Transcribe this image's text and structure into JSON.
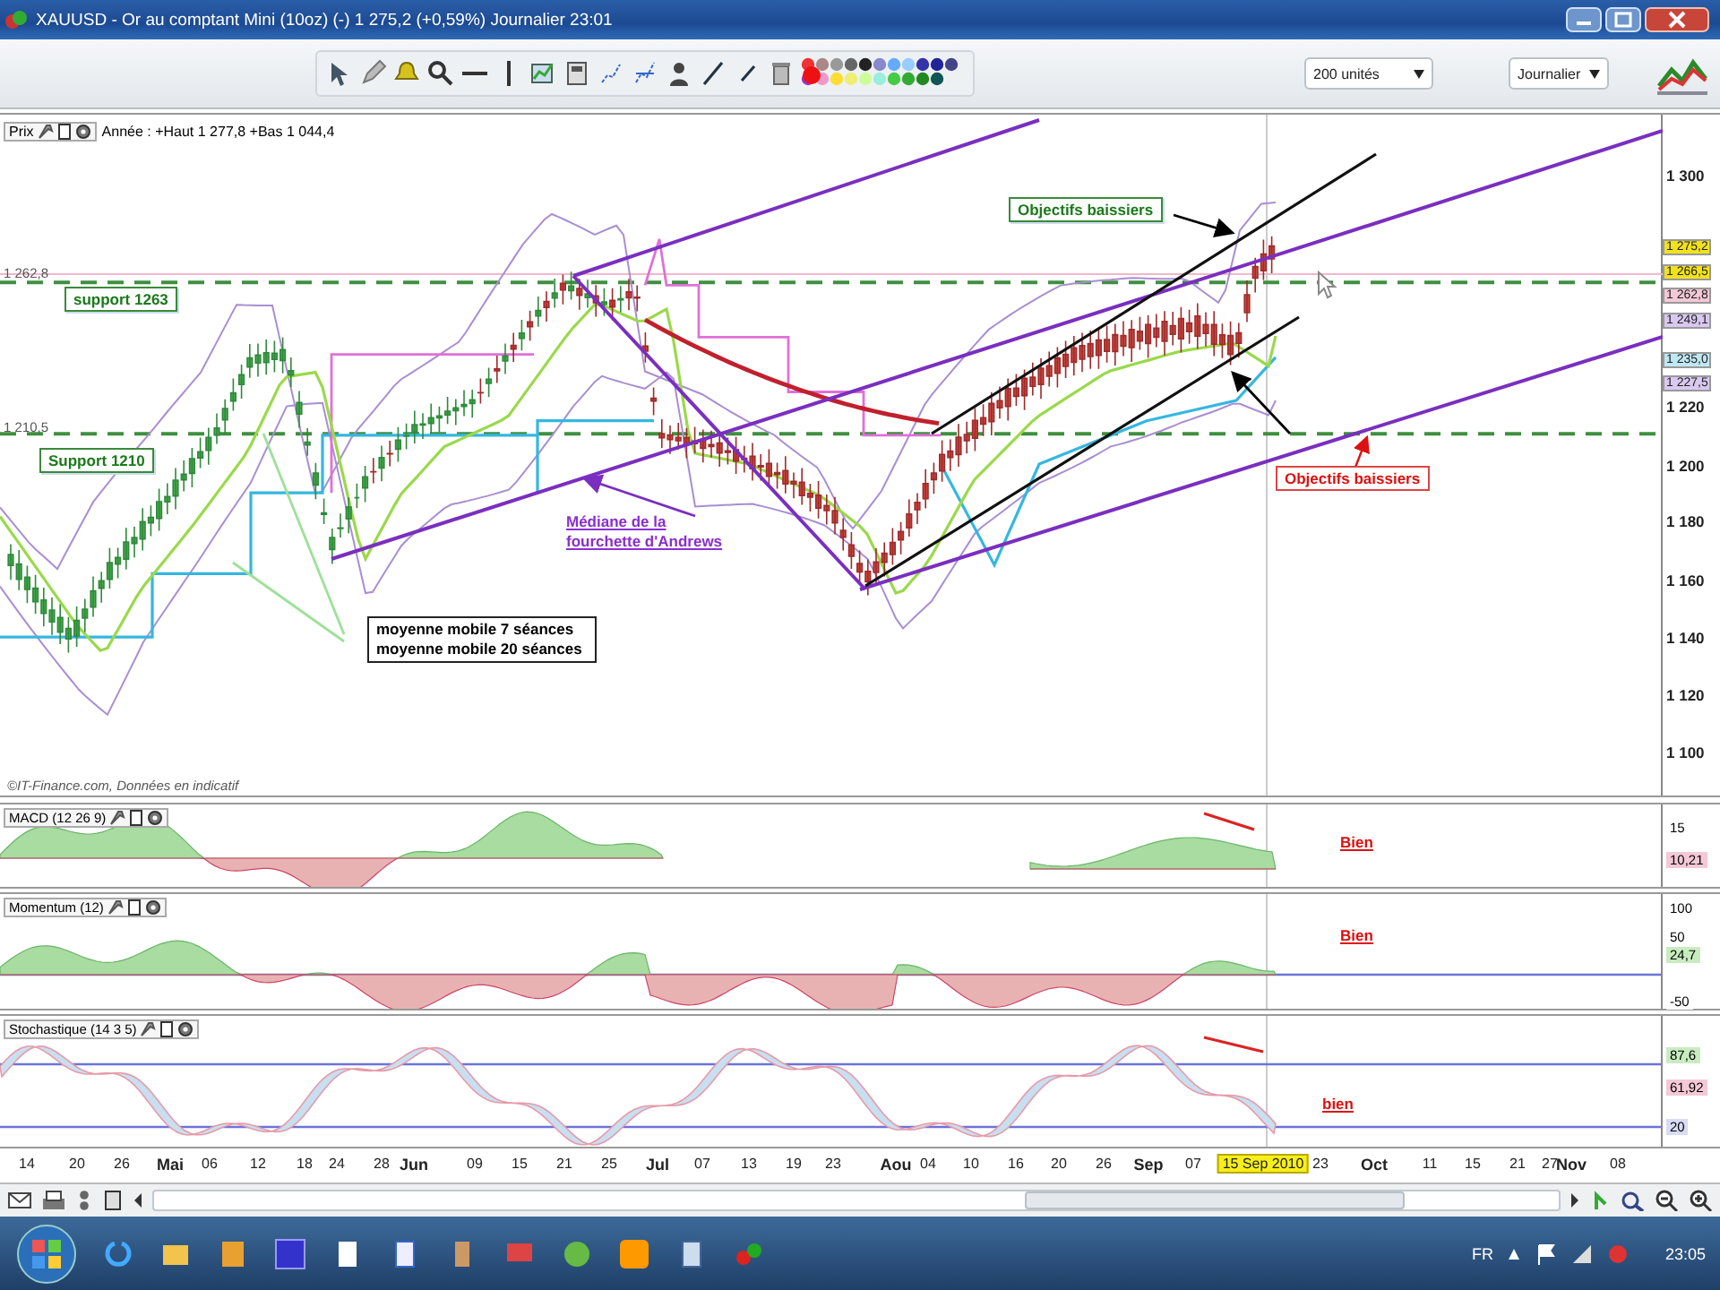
{
  "window": {
    "title": "XAUUSD - Or au comptant Mini (10oz) (-)   1 275,2 (+0,59%)   Journalier  23:01"
  },
  "toolbar": {
    "dropdowns": [
      {
        "value": "200 unités"
      },
      {
        "value": "Journalier"
      }
    ]
  },
  "main_chart": {
    "label": "Prix",
    "range_text": "Année : +Haut 1 277,8 +Bas 1 044,4",
    "level_labels": [
      "1 262,8",
      "1 210,5"
    ],
    "price_axis": [
      "1 300",
      "1 220",
      "1 200",
      "1 180",
      "1 160",
      "1 140",
      "1 120",
      "1 100"
    ],
    "price_tags": [
      {
        "text": "1 275,2",
        "color": "#f2e21c"
      },
      {
        "text": "1 266,5",
        "color": "#f2e21c"
      },
      {
        "text": "1 262,8",
        "color": "#f4c8d6"
      },
      {
        "text": "1 249,1",
        "color": "#d9c8f0"
      },
      {
        "text": "1 235,0",
        "color": "#bfe8f4"
      },
      {
        "text": "1 227,5",
        "color": "#d9c8f0"
      }
    ],
    "annotations": [
      {
        "text": "support 1263",
        "kind": "green_box"
      },
      {
        "text": "Support 1210",
        "kind": "green_box"
      },
      {
        "text": "Objectifs baissiers",
        "kind": "green_box"
      },
      {
        "text": "Objectifs baissiers",
        "kind": "red_box"
      },
      {
        "text": "Médiane de la fourchette d'Andrews",
        "kind": "link"
      },
      {
        "text": "moyenne mobile 7 séances moyenne mobile 20 séances",
        "kind": "black_box"
      }
    ],
    "copyright": "©IT-Finance.com, Données en indicatif"
  },
  "indicators": [
    {
      "kind": "macd",
      "label": "MACD (12 26 9)",
      "note": "Bien",
      "axis": [
        {
          "text": "15",
          "color": "#ffffff"
        },
        {
          "text": "10,21",
          "color": "#f4c8d6"
        }
      ]
    },
    {
      "kind": "momentum",
      "label": "Momentum (12)",
      "note": "Bien",
      "axis": [
        {
          "text": "100",
          "color": "#ffffff"
        },
        {
          "text": "50",
          "color": "#ffffff"
        },
        {
          "text": "24,7",
          "color": "#c8ecc0"
        },
        {
          "text": "-50",
          "color": "#ffffff"
        }
      ]
    },
    {
      "kind": "stochastic",
      "label": "Stochastique (14 3 5)",
      "note": "bien",
      "axis": [
        {
          "text": "87,6",
          "color": "#c8ecc0"
        },
        {
          "text": "61,92",
          "color": "#f4c8d6"
        },
        {
          "text": "20",
          "color": "#d8dcf4"
        }
      ]
    }
  ],
  "x_axis": [
    {
      "label": "14",
      "kind": "day",
      "selected": false
    },
    {
      "label": "20",
      "kind": "day",
      "selected": false
    },
    {
      "label": "26",
      "kind": "day",
      "selected": false
    },
    {
      "label": "Mai",
      "kind": "month",
      "selected": false
    },
    {
      "label": "06",
      "kind": "day",
      "selected": false
    },
    {
      "label": "12",
      "kind": "day",
      "selected": false
    },
    {
      "label": "18",
      "kind": "day",
      "selected": false
    },
    {
      "label": "24",
      "kind": "day",
      "selected": false
    },
    {
      "label": "28",
      "kind": "day",
      "selected": false
    },
    {
      "label": "Jun",
      "kind": "month",
      "selected": false
    },
    {
      "label": "09",
      "kind": "day",
      "selected": false
    },
    {
      "label": "15",
      "kind": "day",
      "selected": false
    },
    {
      "label": "21",
      "kind": "day",
      "selected": false
    },
    {
      "label": "25",
      "kind": "day",
      "selected": false
    },
    {
      "label": "Jul",
      "kind": "month",
      "selected": false
    },
    {
      "label": "07",
      "kind": "day",
      "selected": false
    },
    {
      "label": "13",
      "kind": "day",
      "selected": false
    },
    {
      "label": "19",
      "kind": "day",
      "selected": false
    },
    {
      "label": "23",
      "kind": "day",
      "selected": false
    },
    {
      "label": "Aou",
      "kind": "month",
      "selected": false
    },
    {
      "label": "04",
      "kind": "day",
      "selected": false
    },
    {
      "label": "10",
      "kind": "day",
      "selected": false
    },
    {
      "label": "16",
      "kind": "day",
      "selected": false
    },
    {
      "label": "20",
      "kind": "day",
      "selected": false
    },
    {
      "label": "26",
      "kind": "day",
      "selected": false
    },
    {
      "label": "Sep",
      "kind": "month",
      "selected": false
    },
    {
      "label": "07",
      "kind": "day",
      "selected": false
    },
    {
      "label": "15 Sep 2010",
      "kind": "day",
      "selected": true
    },
    {
      "label": "23",
      "kind": "day",
      "selected": false
    },
    {
      "label": "Oct",
      "kind": "month",
      "selected": false
    },
    {
      "label": "11",
      "kind": "day",
      "selected": false
    },
    {
      "label": "15",
      "kind": "day",
      "selected": false
    },
    {
      "label": "21",
      "kind": "day",
      "selected": false
    },
    {
      "label": "27",
      "kind": "day",
      "selected": false
    },
    {
      "label": "Nov",
      "kind": "month",
      "selected": false
    },
    {
      "label": "08",
      "kind": "day",
      "selected": false
    }
  ],
  "taskbar": {
    "language": "FR",
    "clock": "23:05"
  }
}
